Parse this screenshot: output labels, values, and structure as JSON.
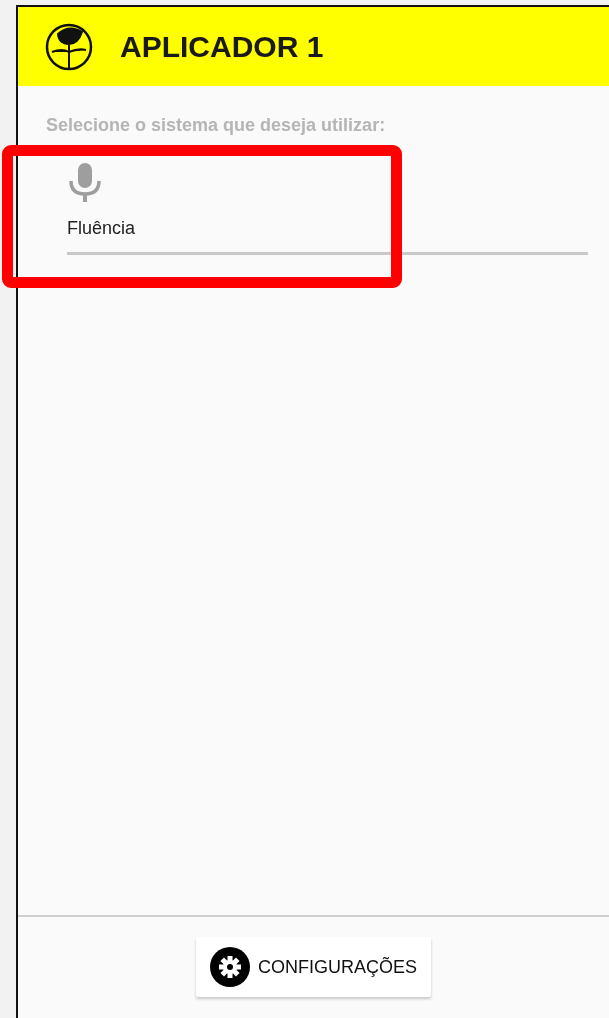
{
  "app_bar": {
    "title": "APLICADOR 1"
  },
  "prompt": "Selecione o sistema que deseja utilizar:",
  "systems": [
    {
      "label": "Fluência",
      "highlighted": true
    }
  ],
  "footer": {
    "button": "CONFIGURAÇÕES"
  }
}
